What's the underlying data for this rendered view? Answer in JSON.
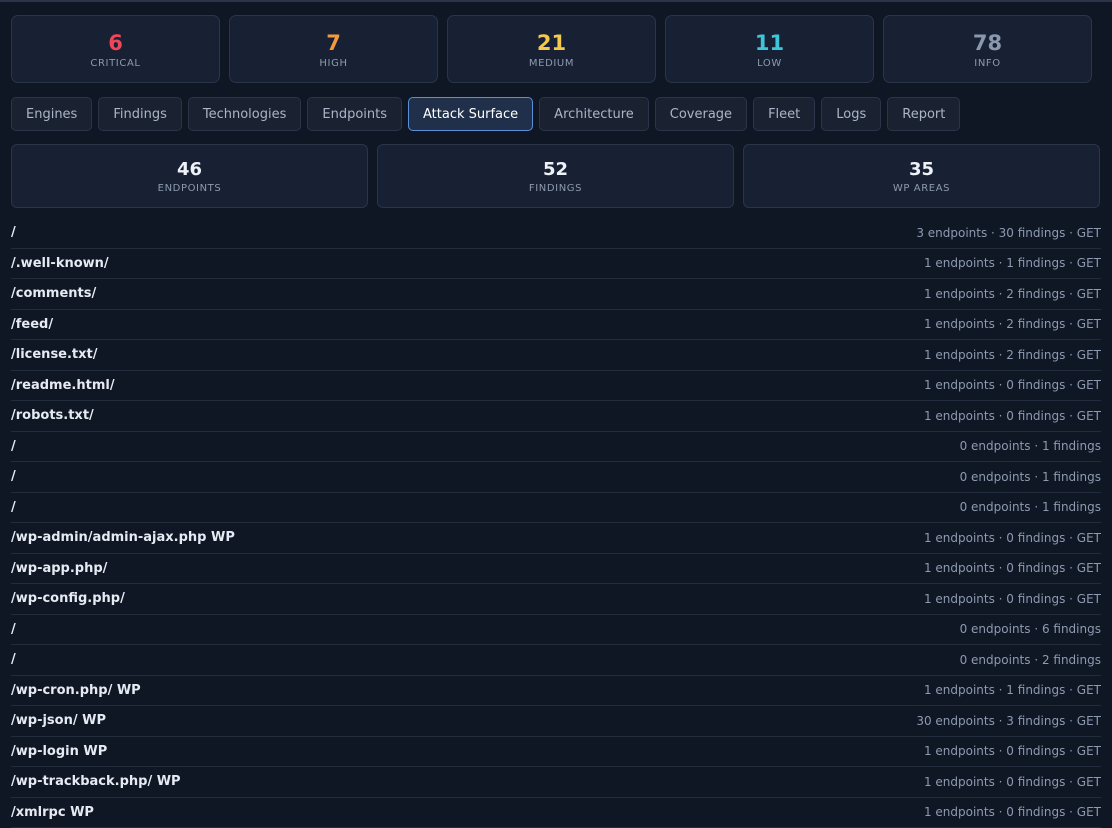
{
  "severity": [
    {
      "count": "6",
      "label": "CRITICAL",
      "color": "#f0465a"
    },
    {
      "count": "7",
      "label": "HIGH",
      "color": "#f59a3c"
    },
    {
      "count": "21",
      "label": "MEDIUM",
      "color": "#f2c94c"
    },
    {
      "count": "11",
      "label": "LOW",
      "color": "#3cc6d8"
    },
    {
      "count": "78",
      "label": "INFO",
      "color": "#8a97ad"
    }
  ],
  "tabs": [
    {
      "label": "Engines"
    },
    {
      "label": "Findings"
    },
    {
      "label": "Technologies"
    },
    {
      "label": "Endpoints"
    },
    {
      "label": "Attack Surface"
    },
    {
      "label": "Architecture"
    },
    {
      "label": "Coverage"
    },
    {
      "label": "Fleet"
    },
    {
      "label": "Logs"
    },
    {
      "label": "Report"
    }
  ],
  "active_tab": "Attack Surface",
  "stats": [
    {
      "value": "46",
      "label": "ENDPOINTS"
    },
    {
      "value": "52",
      "label": "FINDINGS"
    },
    {
      "value": "35",
      "label": "WP AREAS"
    }
  ],
  "surface_rows": [
    {
      "path": "/",
      "meta": "3 endpoints · 30 findings · GET"
    },
    {
      "path": "/.well-known/",
      "meta": "1 endpoints · 1 findings · GET"
    },
    {
      "path": "/comments/",
      "meta": "1 endpoints · 2 findings · GET"
    },
    {
      "path": "/feed/",
      "meta": "1 endpoints · 2 findings · GET"
    },
    {
      "path": "/license.txt/",
      "meta": "1 endpoints · 2 findings · GET"
    },
    {
      "path": "/readme.html/",
      "meta": "1 endpoints · 0 findings · GET"
    },
    {
      "path": "/robots.txt/",
      "meta": "1 endpoints · 0 findings · GET"
    },
    {
      "path": "/",
      "meta": "0 endpoints · 1 findings"
    },
    {
      "path": "/",
      "meta": "0 endpoints · 1 findings"
    },
    {
      "path": "/",
      "meta": "0 endpoints · 1 findings"
    },
    {
      "path": "/wp-admin/admin-ajax.php WP",
      "meta": "1 endpoints · 0 findings · GET"
    },
    {
      "path": "/wp-app.php/",
      "meta": "1 endpoints · 0 findings · GET"
    },
    {
      "path": "/wp-config.php/",
      "meta": "1 endpoints · 0 findings · GET"
    },
    {
      "path": "/",
      "meta": "0 endpoints · 6 findings"
    },
    {
      "path": "/",
      "meta": "0 endpoints · 2 findings"
    },
    {
      "path": "/wp-cron.php/ WP",
      "meta": "1 endpoints · 1 findings · GET"
    },
    {
      "path": "/wp-json/ WP",
      "meta": "30 endpoints · 3 findings · GET"
    },
    {
      "path": "/wp-login WP",
      "meta": "1 endpoints · 0 findings · GET"
    },
    {
      "path": "/wp-trackback.php/ WP",
      "meta": "1 endpoints · 0 findings · GET"
    },
    {
      "path": "/xmlrpc WP",
      "meta": "1 endpoints · 0 findings · GET"
    }
  ]
}
